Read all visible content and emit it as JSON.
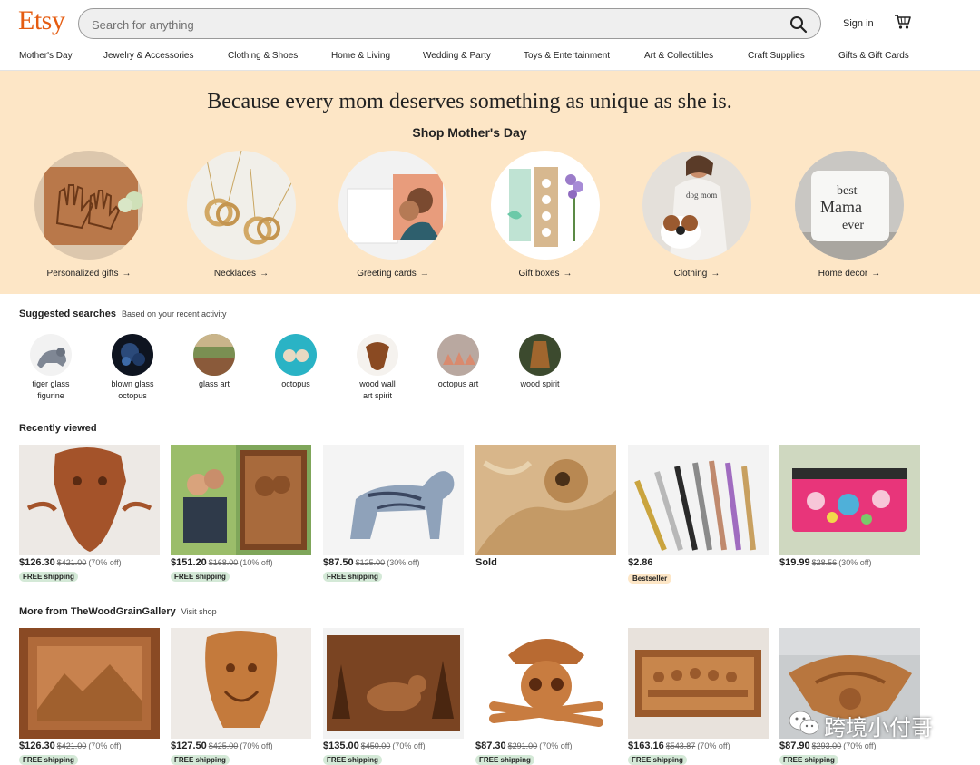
{
  "header": {
    "logo": "Etsy",
    "search_placeholder": "Search for anything",
    "search_value": "",
    "sign_in": "Sign in"
  },
  "categories_nav": [
    "Mother's Day",
    "Jewelry & Accessories",
    "Clothing & Shoes",
    "Home & Living",
    "Wedding & Party",
    "Toys & Entertainment",
    "Art & Collectibles",
    "Craft Supplies",
    "Gifts & Gift Cards"
  ],
  "banner": {
    "headline": "Because every mom deserves something as unique as she is.",
    "subhead": "Shop Mother's Day",
    "categories": [
      "Personalized gifts",
      "Necklaces",
      "Greeting cards",
      "Gift boxes",
      "Clothing",
      "Home decor"
    ],
    "arrow": "→"
  },
  "suggested": {
    "title": "Suggested searches",
    "subtitle": "Based on your recent activity",
    "items": [
      {
        "line1": "tiger glass",
        "line2": "figurine"
      },
      {
        "line1": "blown glass",
        "line2": "octopus"
      },
      {
        "line1": "glass art",
        "line2": ""
      },
      {
        "line1": "octopus",
        "line2": ""
      },
      {
        "line1": "wood wall",
        "line2": "art spirit"
      },
      {
        "line1": "octopus art",
        "line2": ""
      },
      {
        "line1": "wood spirit",
        "line2": ""
      }
    ]
  },
  "recently_viewed": {
    "title": "Recently viewed",
    "items": [
      {
        "price": "$126.30",
        "old": "$421.00",
        "off": "(70% off)",
        "badge": "FREE shipping"
      },
      {
        "price": "$151.20",
        "old": "$168.00",
        "off": "(10% off)",
        "badge": "FREE shipping"
      },
      {
        "price": "$87.50",
        "old": "$125.00",
        "off": "(30% off)",
        "badge": "FREE shipping"
      },
      {
        "status": "Sold"
      },
      {
        "price": "$2.86",
        "bestseller": "Bestseller"
      },
      {
        "price": "$19.99",
        "old": "$28.56",
        "off": "(30% off)"
      }
    ]
  },
  "more_from": {
    "title": "More from TheWoodGrainGallery",
    "link": "Visit shop",
    "items": [
      {
        "price": "$126.30",
        "old": "$421.00",
        "off": "(70% off)",
        "badge": "FREE shipping"
      },
      {
        "price": "$127.50",
        "old": "$425.00",
        "off": "(70% off)",
        "badge": "FREE shipping"
      },
      {
        "price": "$135.00",
        "old": "$450.00",
        "off": "(70% off)",
        "badge": "FREE shipping"
      },
      {
        "price": "$87.30",
        "old": "$291.00",
        "off": "(70% off)",
        "badge": "FREE shipping"
      },
      {
        "price": "$163.16",
        "old": "$543.87",
        "off": "(70% off)",
        "badge": "FREE shipping"
      },
      {
        "price": "$87.90",
        "old": "$293.00",
        "off": "(70% off)",
        "badge": "FREE shipping"
      }
    ]
  },
  "watermark": "跨境小付哥",
  "icons": {
    "search": "search-icon",
    "cart": "shopping-cart-icon",
    "arrow": "arrow-right-icon",
    "watermark": "wechat-icon"
  },
  "colors": {
    "brand": "#e55c11",
    "banner_bg": "#fde6c6",
    "free_shipping_bg": "#d4e9d7"
  }
}
